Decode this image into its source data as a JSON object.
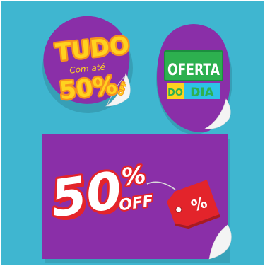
{
  "colors": {
    "background": "#3fb6d0",
    "purple": "#8a2fa8",
    "orange": "#f6921e",
    "yellow": "#ffd21f",
    "red": "#e3242b",
    "white": "#ffffff",
    "green": "#2db04f",
    "teal_panel": "#2ec2e6"
  },
  "sticker_round": {
    "line1": "TUDO",
    "line2": "Com até",
    "line3": "50%",
    "line3_suffix": "OFF"
  },
  "sticker_oval": {
    "line1": "OFERTA",
    "line2_left": "DO",
    "line2_right": "DIA"
  },
  "banner": {
    "main": "50",
    "percent": "%",
    "suffix": "OFF",
    "tag_symbol": "%"
  }
}
